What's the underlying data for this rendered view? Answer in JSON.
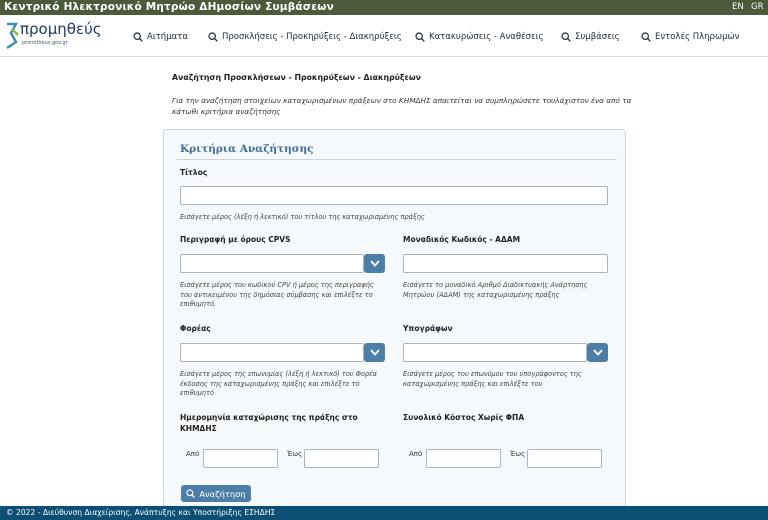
{
  "header": {
    "title": "Κεντρικό Ηλεκτρονικό Μητρώο ΔΗμοσίων Συμβάσεων",
    "lang_en": "EN",
    "lang_gr": "GR"
  },
  "logo": {
    "name": "προμηθεύς",
    "sub": "promitheus.gov.gr"
  },
  "nav": [
    {
      "label": "Αιτήματα",
      "icon": "search-icon"
    },
    {
      "label": "Προσκλήσεις - Προκηρύξεις - Διακηρύξεις",
      "icon": "search-icon"
    },
    {
      "label": "Κατακυρώσεις - Αναθέσεις",
      "icon": "search-icon"
    },
    {
      "label": "Συμβάσεις",
      "icon": "search-icon"
    },
    {
      "label": "Εντολές Πληρωμών",
      "icon": "search-icon"
    }
  ],
  "page": {
    "title": "Αναζήτηση Προσκλήσεων - Προκηρύξεων - Διακηρύξεων",
    "intro": "Για την αναζήτηση στοιχείων καταχωρισμένων πράξεων στο ΚΗΜΔΗΣ απαιτείται να συμπληρώσετε τουλάχιστον ένα από τα κάτωθι κριτήρια αναζήτησης"
  },
  "form": {
    "card_title": "Κριτήρια Αναζήτησης",
    "title_label": "Τίτλος",
    "title_value": "",
    "title_hint": "Εισάγετε μέρος (λέξη ή λεκτικό) του τίτλου της καταχωρισμένης πράξης",
    "cpvs_label": "Περιγραφή με όρους CPVS",
    "cpvs_value": "",
    "cpvs_hint": "Εισάγετε μέρος του κωδικού CPV ή μέρος της περιγραφής του αντικειμένου της δημόσιας σύμβασης και επιλέξτε το επιθυμητό.",
    "adam_label": "Μοναδικός Κωδικός - ΑΔΑΜ",
    "adam_value": "",
    "adam_hint": "Εισάγετε το μοναδικό Αριθμό Διαδικτυακής Ανάρτησης Μητρώου (ΑΔΑΜ) της καταχωρισμένης πράξης",
    "foreas_label": "Φορέας",
    "foreas_value": "",
    "foreas_hint": "Εισάγετε μέρος της επωνυμίας (λέξη ή λεκτικό) του Φορέα έκδοσης της καταχωρισμένης πράξης και επιλέξτε το επιθυμητό",
    "signer_label": "Υπογράφων",
    "signer_value": "",
    "signer_hint": "Εισάγετε μέρος του επωνύμου του υπογράφοντος της καταχωρισμένης πράξης και επιλέξτε τον",
    "date_label": "Ημερομηνία καταχώρισης της πράξης στο ΚΗΜΔΗΣ",
    "cost_label": "Συνολικό Κόστος Χωρίς ΦΠΑ",
    "from_label": "Από",
    "to_label": "Έως",
    "date_from": "",
    "date_to": "",
    "cost_from": "",
    "cost_to": "",
    "search_button": "Αναζήτηση"
  },
  "footer": {
    "text": "© 2022 - Διεύθυνση Διαχείρισης, Ανάπτυξης και Υποστήριξης ΕΣΗΔΗΣ"
  },
  "colors": {
    "header_bg": "#4a5a3a",
    "accent": "#4d7ea8",
    "card_title": "#3e6d99",
    "footer_bg": "#0c4f74"
  }
}
